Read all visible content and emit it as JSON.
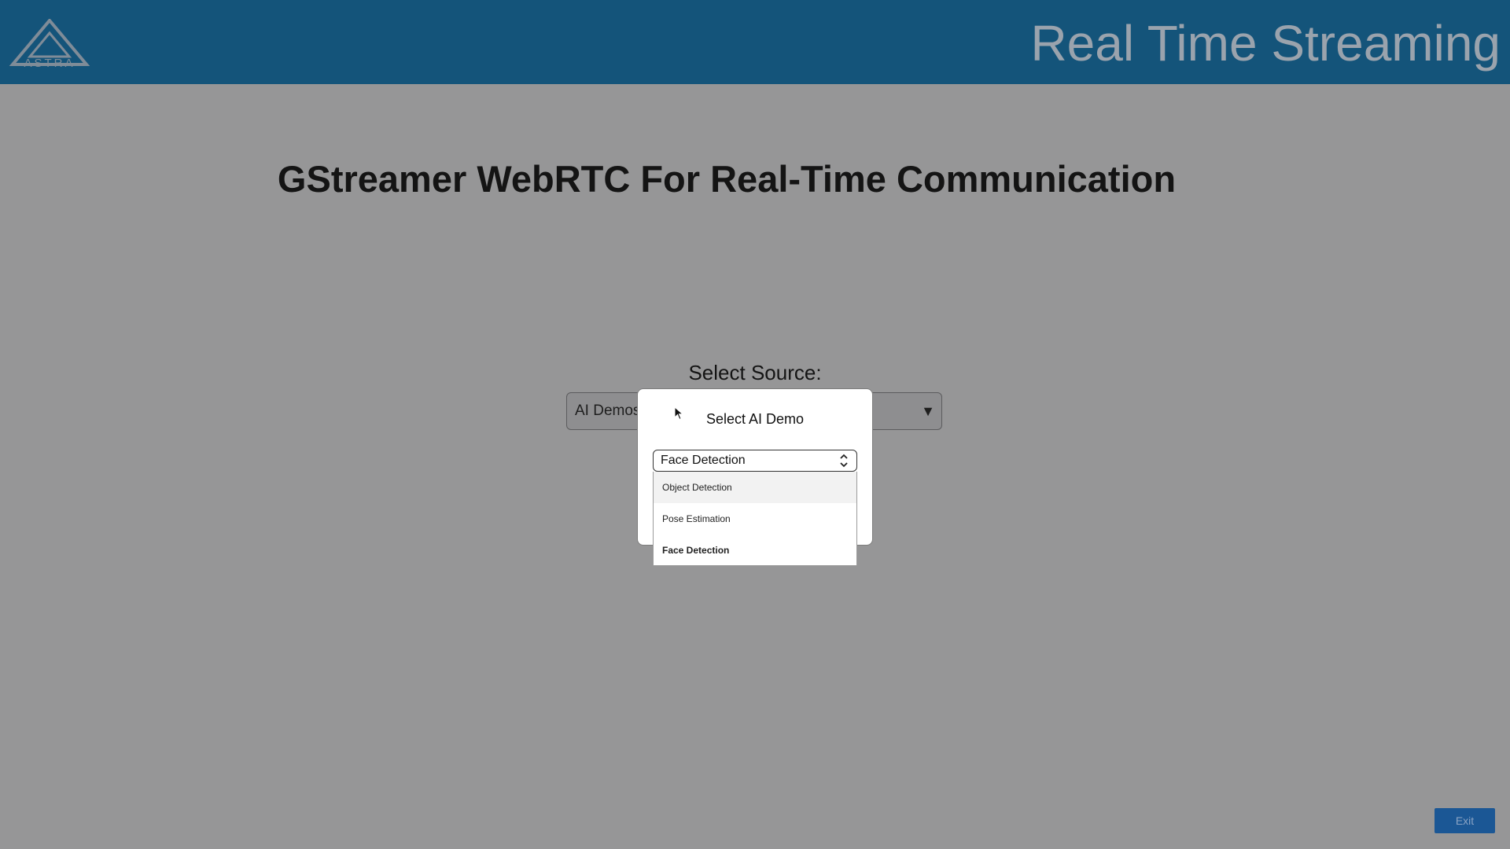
{
  "header": {
    "logo_text": "ASTRA",
    "title": "Real Time Streaming"
  },
  "main": {
    "title": "GStreamer WebRTC For Real-Time Communication",
    "source_label": "Select Source:",
    "source_select_value": "AI Demos",
    "source_select_arrow": "▼"
  },
  "modal": {
    "title": "Select AI Demo",
    "selected_value": "Face Detection",
    "options": [
      {
        "label": "Object Detection",
        "highlighted": true
      },
      {
        "label": "Pose Estimation",
        "highlighted": false
      },
      {
        "label": "Face Detection",
        "selected": true
      }
    ]
  },
  "footer": {
    "exit_label": "Exit"
  },
  "colors": {
    "header_bg": "#14547a",
    "overlay_bg": "#969697",
    "exit_button": "#1b5795"
  },
  "icons": [
    "astra-logo-icon",
    "dropdown-arrow-icon",
    "select-arrows-icon",
    "mouse-cursor-icon"
  ]
}
